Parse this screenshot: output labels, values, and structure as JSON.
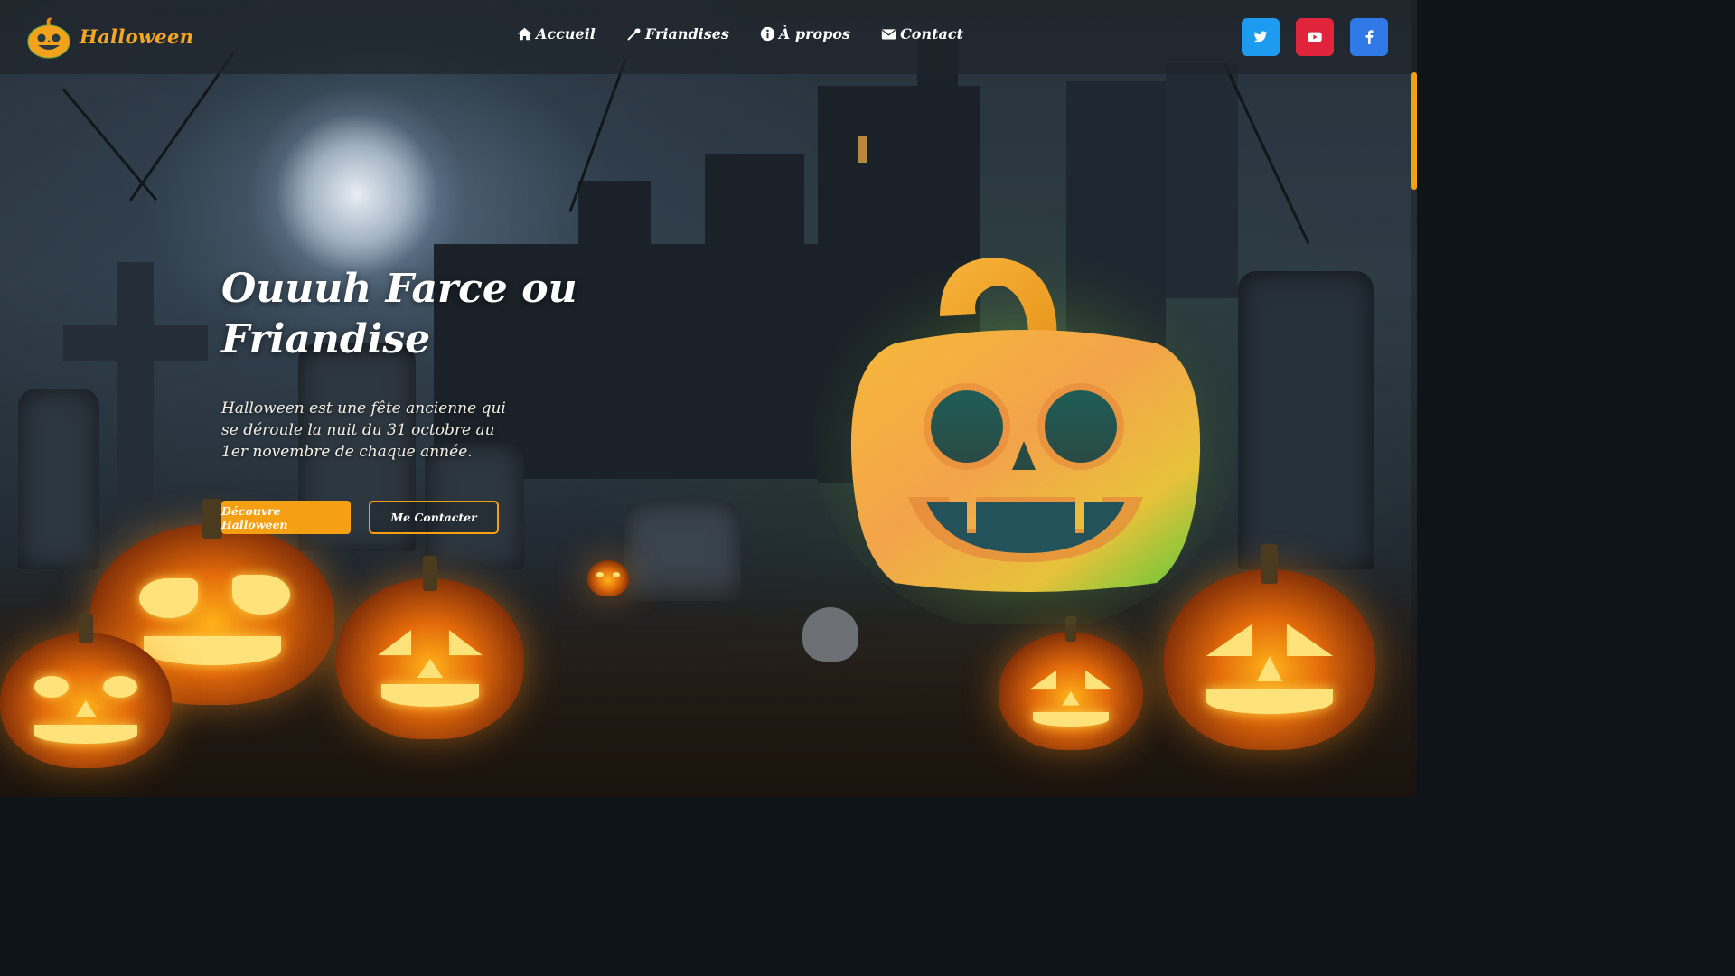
{
  "brand": {
    "name": "Halloween",
    "logo_icon": "pumpkin-logo-icon"
  },
  "nav": {
    "items": [
      {
        "label": "Accueil",
        "icon": "home-icon"
      },
      {
        "label": "Friandises",
        "icon": "candy-icon"
      },
      {
        "label": "À propos",
        "icon": "info-icon"
      },
      {
        "label": "Contact",
        "icon": "envelope-icon"
      }
    ]
  },
  "socials": [
    {
      "name": "twitter",
      "icon": "twitter-icon",
      "color": "#1d9bf0"
    },
    {
      "name": "youtube",
      "icon": "youtube-icon",
      "color": "#e0243b"
    },
    {
      "name": "facebook",
      "icon": "facebook-icon",
      "color": "#2f78e6"
    }
  ],
  "hero": {
    "title_line1": "Ouuuh Farce ou",
    "title_line2": "Friandise",
    "description": "Halloween est une fête ancienne qui se déroule la nuit du 31 octobre au 1er novembre de chaque année.",
    "primary_button": "Découvre Halloween",
    "secondary_button": "Me Contacter"
  },
  "colors": {
    "accent": "#f59f12",
    "brand": "#f5a623",
    "text": "#ffffff"
  }
}
